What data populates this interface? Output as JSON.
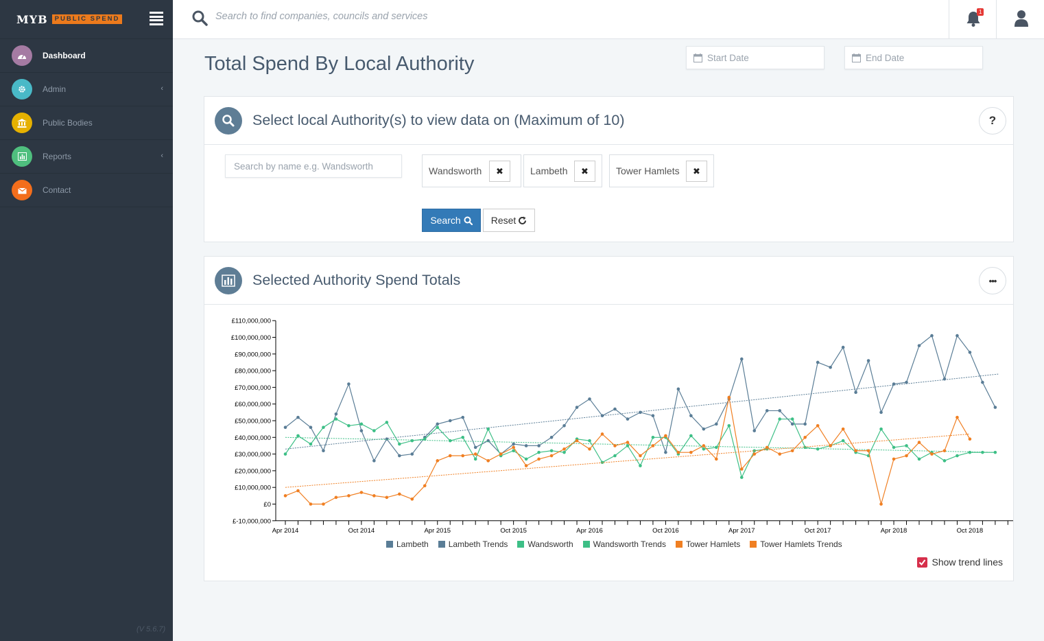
{
  "brand": {
    "name": "MYB",
    "tag": "PUBLIC SPEND"
  },
  "sidebar": {
    "items": [
      {
        "label": "Dashboard",
        "icon": "dashboard-icon",
        "color": "#a57ba3",
        "active": true,
        "chevron": false
      },
      {
        "label": "Admin",
        "icon": "gear-icon",
        "color": "#49b9c7",
        "active": false,
        "chevron": true
      },
      {
        "label": "Public Bodies",
        "icon": "bank-icon",
        "color": "#e6b100",
        "active": false,
        "chevron": false
      },
      {
        "label": "Reports",
        "icon": "bar-chart-icon",
        "color": "#4fbf7e",
        "active": false,
        "chevron": true
      },
      {
        "label": "Contact",
        "icon": "envelope-icon",
        "color": "#f36e1c",
        "active": false,
        "chevron": false
      }
    ],
    "chevron_glyph": "‹",
    "version": "(V 5.6.7)"
  },
  "topbar": {
    "search_placeholder": "Search to find companies, councils and services",
    "notification_count": "1"
  },
  "page": {
    "title": "Total Spend By Local Authority",
    "start_date_placeholder": "Start Date",
    "end_date_placeholder": "End Date"
  },
  "select_card": {
    "title": "Select local Authority(s) to view data on (Maximum of 10)",
    "help_label": "?",
    "search_placeholder": "Search by name e.g. Wandsworth",
    "selected": [
      "Wandsworth",
      "Lambeth",
      "Tower Hamlets"
    ],
    "remove_glyph": "✖",
    "search_button": "Search",
    "reset_button": "Reset"
  },
  "chart_card": {
    "title": "Selected Authority Spend Totals",
    "menu_label": "•••",
    "show_trend_lines": "Show trend lines",
    "trend_lines_checked": true
  },
  "colors": {
    "lambeth": "#5a7d96",
    "wandsworth": "#3dbf86",
    "tower_hamlets": "#f07f22"
  },
  "chart_data": {
    "type": "line",
    "x": [
      "Apr 2014",
      "May 2014",
      "Jun 2014",
      "Jul 2014",
      "Aug 2014",
      "Sep 2014",
      "Oct 2014",
      "Nov 2014",
      "Dec 2014",
      "Jan 2015",
      "Feb 2015",
      "Mar 2015",
      "Apr 2015",
      "May 2015",
      "Jun 2015",
      "Jul 2015",
      "Aug 2015",
      "Sep 2015",
      "Oct 2015",
      "Nov 2015",
      "Dec 2015",
      "Jan 2016",
      "Feb 2016",
      "Mar 2016",
      "Apr 2016",
      "May 2016",
      "Jun 2016",
      "Jul 2016",
      "Aug 2016",
      "Sep 2016",
      "Oct 2016",
      "Nov 2016",
      "Dec 2016",
      "Jan 2017",
      "Feb 2017",
      "Mar 2017",
      "Apr 2017",
      "May 2017",
      "Jun 2017",
      "Jul 2017",
      "Aug 2017",
      "Sep 2017",
      "Oct 2017",
      "Nov 2017",
      "Dec 2017",
      "Jan 2018",
      "Feb 2018",
      "Mar 2018",
      "Apr 2018",
      "May 2018",
      "Jun 2018",
      "Jul 2018",
      "Aug 2018",
      "Sep 2018",
      "Oct 2018",
      "Nov 2018",
      "Dec 2018",
      "Jan 2019"
    ],
    "x_tick_labels": [
      "Apr 2014",
      "Oct 2014",
      "Apr 2015",
      "Oct 2015",
      "Apr 2016",
      "Oct 2016",
      "Apr 2017",
      "Oct 2017",
      "Apr 2018",
      "Oct 2018"
    ],
    "ylim": [
      -10000000,
      110000000
    ],
    "y_tick_labels": [
      "£-10,000,000",
      "£0",
      "£10,000,000",
      "£20,000,000",
      "£30,000,000",
      "£40,000,000",
      "£50,000,000",
      "£60,000,000",
      "£70,000,000",
      "£80,000,000",
      "£90,000,000",
      "£100,000,000",
      "£110,000,000"
    ],
    "series": [
      {
        "name": "Lambeth",
        "color": "#5a7d96",
        "values": [
          46000000,
          52000000,
          46000000,
          32000000,
          54000000,
          72000000,
          44000000,
          26000000,
          39000000,
          29000000,
          30000000,
          40000000,
          48000000,
          50000000,
          52000000,
          34000000,
          38000000,
          30000000,
          36000000,
          35000000,
          35000000,
          40000000,
          47000000,
          58000000,
          63000000,
          53000000,
          57000000,
          51000000,
          55000000,
          53000000,
          31000000,
          69000000,
          53000000,
          45000000,
          48000000,
          63000000,
          87000000,
          44000000,
          56000000,
          56000000,
          48000000,
          48000000,
          85000000,
          82000000,
          94000000,
          67000000,
          86000000,
          55000000,
          72000000,
          73000000,
          95000000,
          101000000,
          75000000,
          101000000,
          91000000,
          73000000,
          58000000
        ]
      },
      {
        "name": "Lambeth Trends",
        "color": "#5a7d96",
        "dashed": true,
        "values": [
          33000000,
          78000000
        ]
      },
      {
        "name": "Wandsworth",
        "color": "#3dbf86",
        "values": [
          30000000,
          41000000,
          36000000,
          46000000,
          51000000,
          47000000,
          48000000,
          44000000,
          49000000,
          36000000,
          38000000,
          39000000,
          46000000,
          38000000,
          40000000,
          27000000,
          45000000,
          29000000,
          32000000,
          27000000,
          31000000,
          32000000,
          31000000,
          39000000,
          38000000,
          25000000,
          29000000,
          35000000,
          23000000,
          40000000,
          40000000,
          30000000,
          41000000,
          33000000,
          34000000,
          47000000,
          16000000,
          32000000,
          33000000,
          51000000,
          51000000,
          34000000,
          33000000,
          35000000,
          38000000,
          31000000,
          29000000,
          45000000,
          34000000,
          35000000,
          27000000,
          31000000,
          26000000,
          29000000,
          31000000,
          31000000,
          31000000
        ]
      },
      {
        "name": "Wandsworth Trends",
        "color": "#3dbf86",
        "dashed": true,
        "values": [
          40000000,
          31000000
        ]
      },
      {
        "name": "Tower Hamlets",
        "color": "#f07f22",
        "values": [
          5000000,
          8000000,
          0,
          0,
          4000000,
          5000000,
          7000000,
          5000000,
          4000000,
          6000000,
          3000000,
          11000000,
          26000000,
          29000000,
          29000000,
          30000000,
          26000000,
          30000000,
          34000000,
          23000000,
          27000000,
          29000000,
          33000000,
          38000000,
          33000000,
          42000000,
          35000000,
          37000000,
          29000000,
          35000000,
          41000000,
          31000000,
          31000000,
          35000000,
          27000000,
          64000000,
          21000000,
          30000000,
          34000000,
          30000000,
          32000000,
          40000000,
          47000000,
          35000000,
          45000000,
          32000000,
          32000000,
          0,
          27000000,
          29000000,
          37000000,
          30000000,
          32000000,
          52000000,
          39000000
        ]
      },
      {
        "name": "Tower Hamlets Trends",
        "color": "#f07f22",
        "dashed": true,
        "values": [
          10000000,
          42000000
        ]
      }
    ],
    "legend": [
      "Lambeth",
      "Lambeth Trends",
      "Wandsworth",
      "Wandsworth Trends",
      "Tower Hamlets",
      "Tower Hamlets Trends"
    ],
    "legend_position": "bottom",
    "grid": false
  }
}
